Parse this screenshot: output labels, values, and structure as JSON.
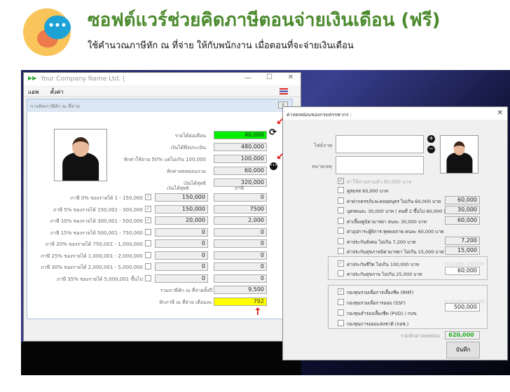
{
  "banner": {
    "title": "ซอฟต์แวร์ช่วยคิดภาษีตอนจ่ายเงินเดือน (ฟรี)",
    "subtitle": "ใช้คำนวณภาษีหัก ณ ที่จ่าย ให้กับพนักงาน เมื่อตอนที่จะจ่ายเงินเดือน",
    "logo_dots": "•••"
  },
  "main_window": {
    "title": "Your Company Name Ltd. |",
    "menu": [
      "แอพ",
      "ตั้งค่า"
    ],
    "form_title": "การคิดภาษีหัก ณ ที่จ่าย",
    "fields": [
      {
        "label": "รายได้ต่อเดือน",
        "value": "40,000"
      },
      {
        "label": "เงินได้พึงประเมิน",
        "value": "480,000"
      },
      {
        "label": "หักค่าใช้จ่าย 50% แต่ไม่เกิน 100,000",
        "value": "100,000"
      },
      {
        "label": "หักค่าลดหย่อนรวม",
        "value": "60,000"
      },
      {
        "label": "เงินได้สุทธิ",
        "value": "320,000"
      }
    ],
    "col_headers": [
      "เงินได้สุทธิ",
      "ภาษี"
    ],
    "brackets": [
      {
        "label": "ภาษี 0% ของรายได้ 1 - 150,000",
        "checked": true,
        "net": "150,000",
        "tax": "0"
      },
      {
        "label": "ภาษี 5% ของรายได้ 150,001 - 300,000",
        "checked": true,
        "net": "150,000",
        "tax": "7500"
      },
      {
        "label": "ภาษี 10% ของรายได้ 300,001 - 500,000",
        "checked": true,
        "net": "20,000",
        "tax": "2,000"
      },
      {
        "label": "ภาษี 15% ของรายได้ 500,001 - 750,000",
        "checked": false,
        "net": "0",
        "tax": "0"
      },
      {
        "label": "ภาษี 20% ของรายได้ 750,001 - 1,000,000",
        "checked": false,
        "net": "0",
        "tax": "0"
      },
      {
        "label": "ภาษี 25% ของรายได้ 1,000,001 - 2,000,000",
        "checked": false,
        "net": "0",
        "tax": "0"
      },
      {
        "label": "ภาษี 30% ของรายได้ 2,000,001 - 5,000,000",
        "checked": false,
        "net": "0",
        "tax": "0"
      },
      {
        "label": "ภาษี 35% ของรายได้ 5,000,001 ขึ้นไป",
        "checked": false,
        "net": "0",
        "tax": "0"
      }
    ],
    "total_year": {
      "label": "รวมภาษีหัก ณ ที่จ่ายทั้งปี",
      "value": "9,500"
    },
    "monthly": {
      "label": "หักภาษี ณ ที่จ่าย เดือนละ",
      "value": "792"
    }
  },
  "dialog": {
    "title": "ค่าลดหย่อนของกรมสรรพากร :",
    "file_label": "ไฟล์ภาพ",
    "note_label": "หมายเหตุ",
    "personal": "ค่าใช้จ่ายส่วนตัว 60,000 บาท",
    "items": [
      {
        "label": "คู่สมรส 60,000 บาท",
        "checked": false,
        "value": null
      },
      {
        "label": "ค่าฝากครรภ์และคลอดบุตร ไม่เกิน 60,000 บาท",
        "checked": false,
        "value": "60,000"
      },
      {
        "label": "บุตรคนละ 30,000 บาท ( คนที่ 2 ขึ้นไป 60,000 )",
        "checked": false,
        "value": "30,000"
      },
      {
        "label": "ค่าเลี้ยงดูบิดามารดา คนละ 30,000 บาท",
        "checked": false,
        "value": "60,000"
      },
      {
        "label": "ค่าอุปการะผู้พิการ-ทุพพลภาพ คนละ 60,000 บาท",
        "checked": false,
        "value": null
      },
      {
        "label": "ค่าประกันสังคม ไม่เกิน 7,200 บาท",
        "checked": false,
        "value": "7,200"
      },
      {
        "label": "ค่าประกันสุขภาพบิดามารดา ไม่เกิน 15,000 บาท",
        "checked": false,
        "value": "15,000"
      }
    ],
    "insurance": {
      "note": "(รวมไม่เกิน 100,000)",
      "value": "60,000",
      "items": [
        {
          "label": "ค่าประกันชีวิต ไม่เกิน 100,000 บาท",
          "checked": true
        },
        {
          "label": "ค่าประกันสุขภาพ ไม่เกิน 25,000 บาท",
          "checked": false
        }
      ]
    },
    "funds": {
      "note": "(รวมไม่เกิน 500,000)",
      "value": "500,000",
      "items": [
        {
          "label": "กองทุนรวมเพื่อการเลี้ยงชีพ (RMF)",
          "checked": true
        },
        {
          "label": "กองทุนรวมเพื่อการออม (SSF)",
          "checked": false
        },
        {
          "label": "กองทุนสำรองเลี้ยงชีพ (PVD) / กบข.",
          "checked": false
        },
        {
          "label": "กองทุนการออมแห่งชาติ (กอช.)",
          "checked": false
        }
      ]
    },
    "total": {
      "label": "รวมหักค่าลดหย่อน",
      "value": "620,000"
    },
    "save": "บันทึก"
  }
}
